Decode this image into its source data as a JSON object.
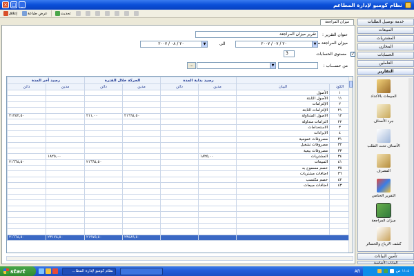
{
  "window": {
    "title": "نظام كومبو لإدارة المطاعم"
  },
  "colors": {
    "titlebar": "#0a4fd8",
    "header_text": "#1f3a93",
    "total_row": "#3a68c4",
    "grid_line": "#c9d5e8"
  },
  "toolbar": {
    "close_label": "إغلاق",
    "print_preview_label": "عرض طباعة",
    "refresh_label": "تحديث",
    "disabled_items": [
      "",
      "",
      "",
      "",
      "",
      "",
      ""
    ]
  },
  "tab": {
    "label": "ميزان المراجعة"
  },
  "form": {
    "report_title_label": "عنوان التقرير :",
    "report_title_value": "تقرير ميزان المراجعة",
    "date_from_label": "ميزان المراجعة من :",
    "date_from_value": "٢٠ / ٠٧ / ٢٠٠٧",
    "date_to_label": "الى",
    "date_to_value": "٢٠ / ٠٨ / ٢٠٠٧",
    "level_label": "مستوى الحسابات",
    "level_value": "3",
    "from_account_label": "من حســـاب :",
    "from_account_value": "",
    "dots_label": "..."
  },
  "grid": {
    "group_headers": [
      "رصيد بداية المدة",
      "الحركة خلال الفترة",
      "رصيد أخر المدة"
    ],
    "code_header": "الكود",
    "name_header": "البيان",
    "debit_header": "مدين",
    "credit_header": "دائن",
    "rows": [
      {
        "code": "١",
        "name": "الأصول",
        "v": [
          "",
          "",
          "",
          "",
          "",
          ""
        ]
      },
      {
        "code": "١١",
        "name": "الأصول الثابتة",
        "v": [
          "",
          "",
          "",
          "",
          "",
          ""
        ]
      },
      {
        "code": "٢",
        "name": "الإلتزامات",
        "v": [
          "",
          "",
          "",
          "",
          "",
          ""
        ]
      },
      {
        "code": "٢١",
        "name": "الإلتزامات الثابتة",
        "v": [
          "",
          "",
          "",
          "",
          "",
          ""
        ]
      },
      {
        "code": "١٢",
        "name": "الأصول المتداولة",
        "v": [
          "",
          "",
          "٢١٦٦٤,٥٠",
          "٢١١,٠٠",
          "",
          "٢١٢٥٢,٥٠"
        ]
      },
      {
        "code": "٢٢",
        "name": "التزامات متداولة",
        "v": [
          "",
          "",
          "",
          "",
          "",
          ""
        ]
      },
      {
        "code": "٣",
        "name": "الاستخدامات",
        "v": [
          "",
          "",
          "",
          "",
          "",
          ""
        ]
      },
      {
        "code": "٤",
        "name": "الايرادات",
        "v": [
          "",
          "",
          "",
          "",
          "",
          ""
        ]
      },
      {
        "code": "٣١",
        "name": "مصروفات عمومية",
        "v": [
          "",
          "",
          "",
          "",
          "",
          ""
        ]
      },
      {
        "code": "٣٢",
        "name": "مصروفات تشغيل",
        "v": [
          "",
          "",
          "",
          "",
          "",
          ""
        ]
      },
      {
        "code": "٣٣",
        "name": "مصروفات بيعية",
        "v": [
          "",
          "",
          "",
          "",
          "",
          ""
        ]
      },
      {
        "code": "٣٤",
        "name": "المشتريات",
        "v": [
          "١٨٢٥,٠٠",
          "",
          "",
          "",
          "١٨٢٥,٠٠",
          ""
        ]
      },
      {
        "code": "٤١",
        "name": "المبيعات",
        "v": [
          "",
          "",
          "",
          "٢١٦٦٤,٥٠",
          "",
          "٢١٦٦٤,٥٠"
        ]
      },
      {
        "code": "٣٥",
        "name": "خصم مسموح به",
        "v": [
          "",
          "",
          "",
          "",
          "",
          ""
        ]
      },
      {
        "code": "٣٦",
        "name": "اضافات مشتريات",
        "v": [
          "",
          "",
          "",
          "",
          "",
          ""
        ]
      },
      {
        "code": "٤٢",
        "name": "خصم مكتسب",
        "v": [
          "",
          "",
          "",
          "",
          "",
          ""
        ]
      },
      {
        "code": "٤٣",
        "name": "اضافات مبيعات",
        "v": [
          "",
          "",
          "",
          "",
          "",
          ""
        ]
      }
    ],
    "total": {
      "v": [
        "",
        "",
        "٢٣٤٨٩,٥٠",
        "٢١٩٧٥,٥٠",
        "٢٣١٧٨,٥٠",
        "٢١٦٦٤,٥٠"
      ]
    }
  },
  "nav": {
    "top_items": [
      "خدمة توصيل الطلبات",
      "المبيعات",
      "المشتريات",
      "المخازن",
      "الحسابات",
      "العاملين",
      "التقارير"
    ],
    "tiles": [
      "المبيعات بالأعداد",
      "جرد الأصناف",
      "الأصناف تحت الطلب",
      "المصرف",
      "التقرير الختامي",
      "ميزان المراجعة",
      "كشف الارباح والخسائر"
    ],
    "bottom_items": [
      "تأمين البيانات",
      "البيانات الأساسية"
    ]
  },
  "taskbar": {
    "start_label": "start",
    "task_label": "نظام كومبو لإدارة المطا...",
    "other_task_label": "",
    "lang": "AR",
    "clock": "١١:٤٠ ص"
  }
}
